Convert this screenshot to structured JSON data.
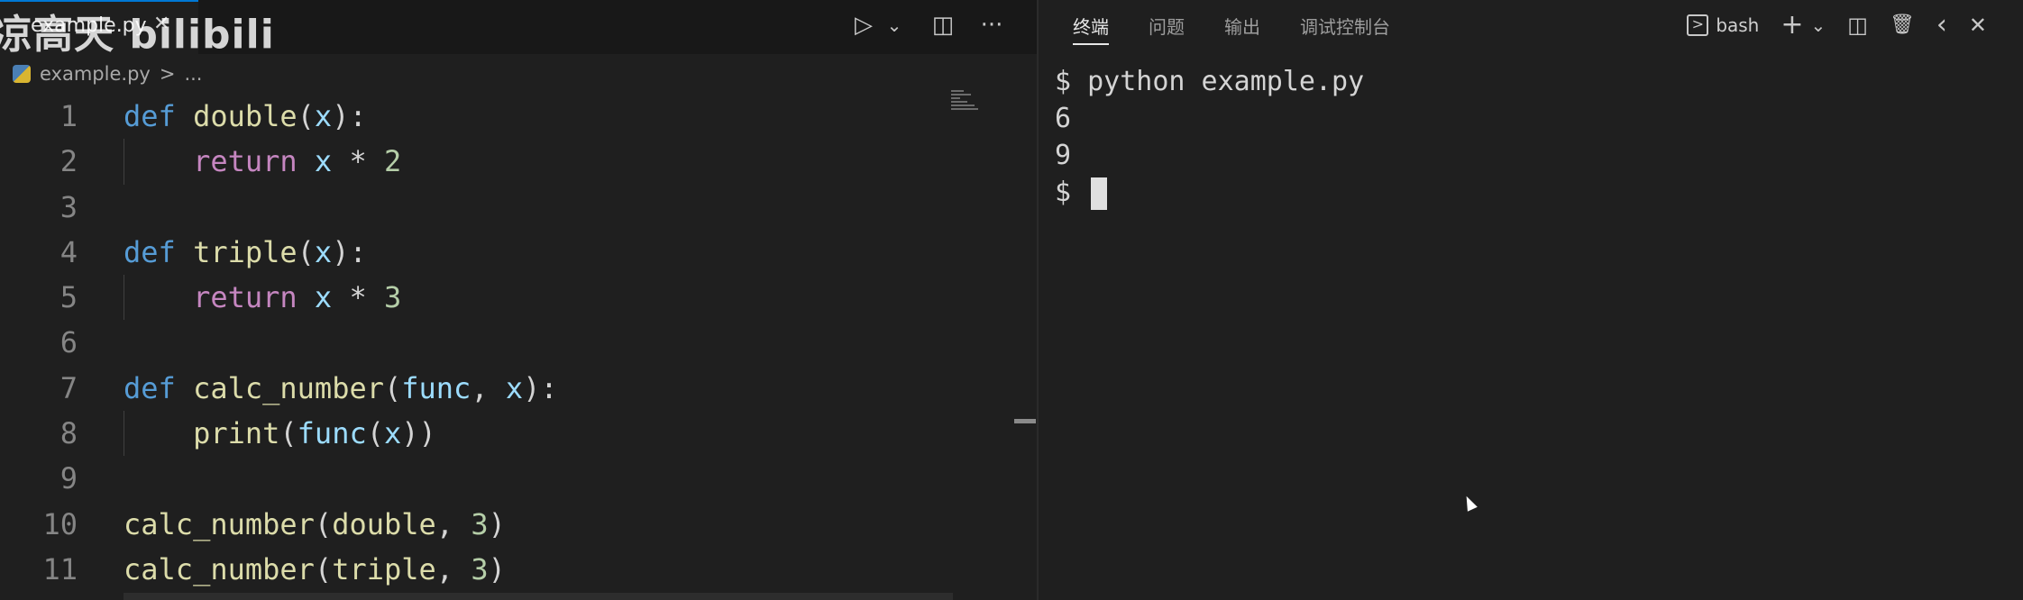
{
  "watermark": "凉高天 bilibili",
  "editor": {
    "tab": {
      "label": "example.py",
      "close": "✕"
    },
    "breadcrumb": {
      "file": "example.py",
      "sep": ">",
      "rest": "..."
    },
    "toolbar": {
      "run": "▷",
      "run_menu": "⌄",
      "split": "◫",
      "more": "···"
    },
    "lines": [
      {
        "n": "1",
        "tokens": [
          {
            "t": "def",
            "c": "kw"
          },
          {
            "t": " ",
            "c": ""
          },
          {
            "t": "double",
            "c": "fn"
          },
          {
            "t": "(",
            "c": ""
          },
          {
            "t": "x",
            "c": "prm"
          },
          {
            "t": "):",
            "c": ""
          }
        ]
      },
      {
        "n": "2",
        "guide": true,
        "tokens": [
          {
            "t": "    ",
            "c": ""
          },
          {
            "t": "return",
            "c": "ctrl"
          },
          {
            "t": " ",
            "c": ""
          },
          {
            "t": "x",
            "c": "prm"
          },
          {
            "t": " * ",
            "c": ""
          },
          {
            "t": "2",
            "c": "num"
          }
        ]
      },
      {
        "n": "3",
        "tokens": []
      },
      {
        "n": "4",
        "tokens": [
          {
            "t": "def",
            "c": "kw"
          },
          {
            "t": " ",
            "c": ""
          },
          {
            "t": "triple",
            "c": "fn"
          },
          {
            "t": "(",
            "c": ""
          },
          {
            "t": "x",
            "c": "prm"
          },
          {
            "t": "):",
            "c": ""
          }
        ]
      },
      {
        "n": "5",
        "guide": true,
        "tokens": [
          {
            "t": "    ",
            "c": ""
          },
          {
            "t": "return",
            "c": "ctrl"
          },
          {
            "t": " ",
            "c": ""
          },
          {
            "t": "x",
            "c": "prm"
          },
          {
            "t": " * ",
            "c": ""
          },
          {
            "t": "3",
            "c": "num"
          }
        ]
      },
      {
        "n": "6",
        "tokens": []
      },
      {
        "n": "7",
        "tokens": [
          {
            "t": "def",
            "c": "kw"
          },
          {
            "t": " ",
            "c": ""
          },
          {
            "t": "calc_number",
            "c": "fn"
          },
          {
            "t": "(",
            "c": ""
          },
          {
            "t": "func",
            "c": "prm"
          },
          {
            "t": ", ",
            "c": ""
          },
          {
            "t": "x",
            "c": "prm"
          },
          {
            "t": "):",
            "c": ""
          }
        ]
      },
      {
        "n": "8",
        "guide": true,
        "tokens": [
          {
            "t": "    ",
            "c": ""
          },
          {
            "t": "print",
            "c": "fn"
          },
          {
            "t": "(",
            "c": ""
          },
          {
            "t": "func",
            "c": "prm"
          },
          {
            "t": "(",
            "c": ""
          },
          {
            "t": "x",
            "c": "prm"
          },
          {
            "t": "))",
            "c": ""
          }
        ]
      },
      {
        "n": "9",
        "tokens": []
      },
      {
        "n": "10",
        "tokens": [
          {
            "t": "calc_number",
            "c": "fn"
          },
          {
            "t": "(",
            "c": ""
          },
          {
            "t": "double",
            "c": "fn"
          },
          {
            "t": ", ",
            "c": ""
          },
          {
            "t": "3",
            "c": "num"
          },
          {
            "t": ")",
            "c": ""
          }
        ]
      },
      {
        "n": "11",
        "tokens": [
          {
            "t": "calc_number",
            "c": "fn"
          },
          {
            "t": "(",
            "c": ""
          },
          {
            "t": "triple",
            "c": "fn"
          },
          {
            "t": ", ",
            "c": ""
          },
          {
            "t": "3",
            "c": "num"
          },
          {
            "t": ")",
            "c": ""
          }
        ]
      }
    ]
  },
  "panel": {
    "tabs": [
      {
        "label": "终端",
        "active": true
      },
      {
        "label": "问题",
        "active": false
      },
      {
        "label": "输出",
        "active": false
      },
      {
        "label": "调试控制台",
        "active": false
      }
    ],
    "actions": {
      "terminal_glyph": ">",
      "shell": "bash",
      "add": "+",
      "add_menu": "⌄",
      "split": "◫",
      "trash": "🗑",
      "back": "‹",
      "close": "✕"
    },
    "terminal": {
      "lines": [
        "$ python example.py",
        "6",
        "9"
      ],
      "prompt": "$ "
    }
  }
}
